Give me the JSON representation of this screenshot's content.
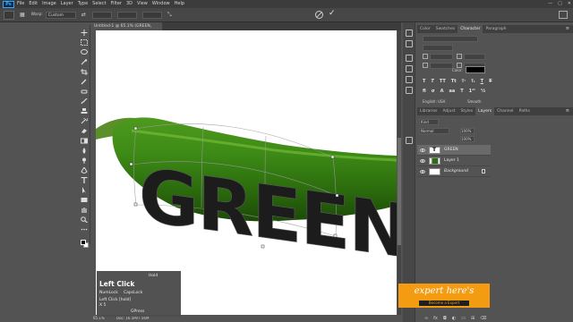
{
  "menubar": {
    "logo": "Ps",
    "items": [
      "File",
      "Edit",
      "Image",
      "Layer",
      "Type",
      "Select",
      "Filter",
      "3D",
      "View",
      "Window",
      "Help"
    ],
    "window_controls": [
      "—",
      "▢",
      "✕"
    ]
  },
  "options": {
    "warp_label": "Warp:",
    "warp_value": "Custom"
  },
  "document": {
    "tab_title": "Untitled-1 @ 65.1% (GREEN, RGB/8) *",
    "close": "×",
    "text_layer": "GREEN"
  },
  "status": {
    "zoom": "65.1%",
    "doc": "Doc: 16.5M/7.56M"
  },
  "key_overlay": {
    "hold": "Hold",
    "left_click": "Left Click",
    "numlock": "NumLock",
    "capslock": "CapsLock",
    "left_click_detail": "Left Click [hold]",
    "count": "X 5",
    "press": "GPress"
  },
  "char_panel": {
    "tabs": [
      "Color",
      "Swatches",
      "Character",
      "Paragraph"
    ],
    "active_tab": "Character",
    "color_label": "Color:",
    "lang": "English: USA",
    "aa": "Smooth",
    "color": "#000000"
  },
  "layers_panel": {
    "tabs": [
      "Libraries",
      "Adjust",
      "Styles",
      "Layers",
      "Channel",
      "Paths"
    ],
    "active_tab": "Layers",
    "kind": "Kind",
    "blend": "Normal",
    "opacity": "100%",
    "fill": "100%",
    "layers": [
      {
        "name": "GREEN",
        "type": "text",
        "selected": true
      },
      {
        "name": "Layer 1",
        "type": "image",
        "selected": false
      },
      {
        "name": "Background",
        "type": "background",
        "selected": false
      }
    ]
  },
  "watermark": {
    "title": "expert here's",
    "subtitle": "Become a Expert"
  }
}
